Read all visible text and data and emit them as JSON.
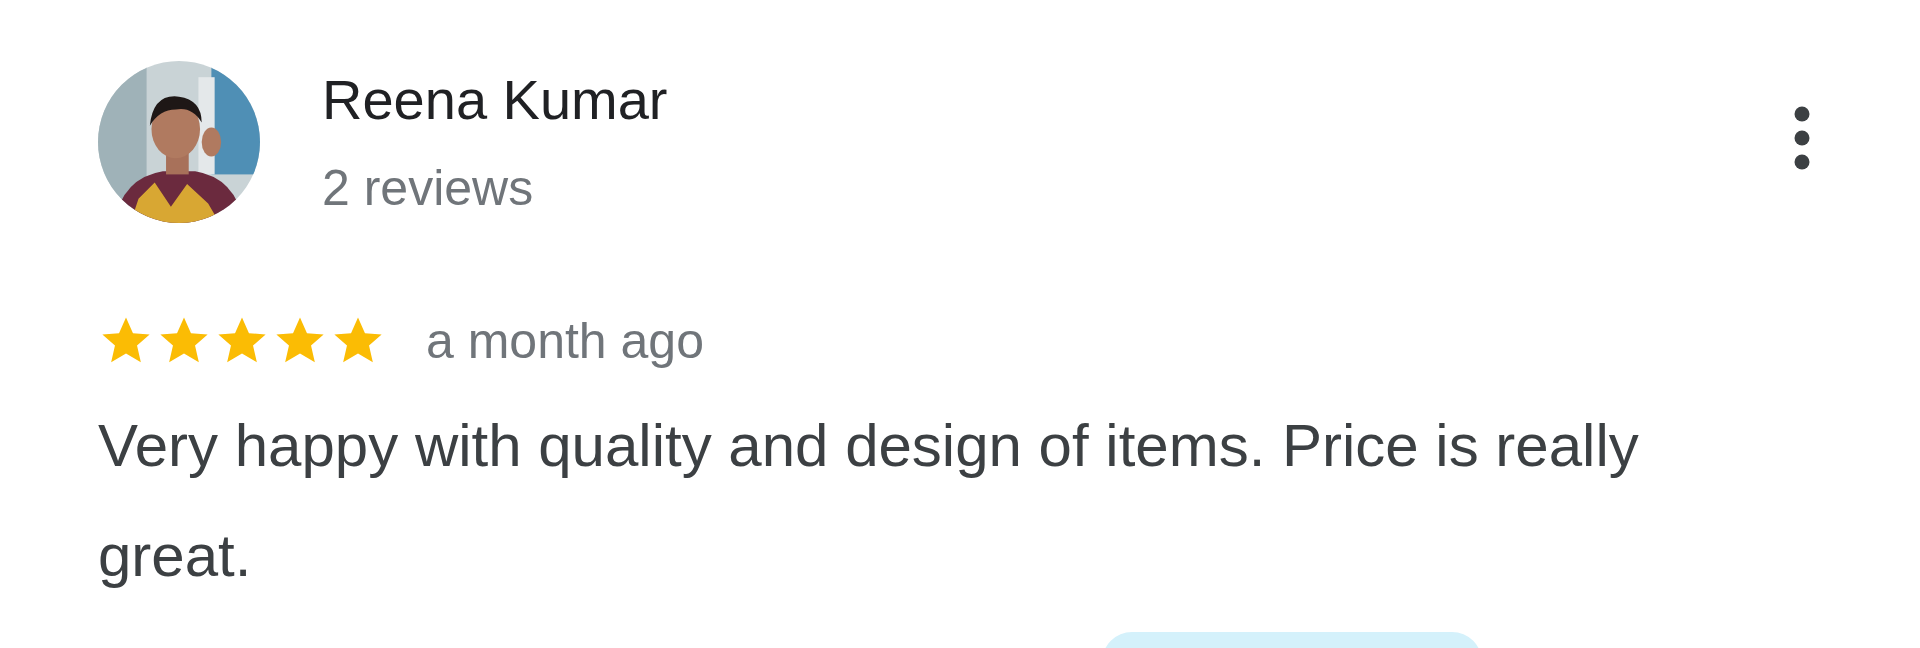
{
  "reviewer": {
    "name": "Reena Kumar",
    "reviews": "2 reviews"
  },
  "review": {
    "stars": 5,
    "time": "a month ago",
    "text": "Very happy with quality and design of items. Price is really great."
  },
  "action": {
    "kind": "pill"
  }
}
